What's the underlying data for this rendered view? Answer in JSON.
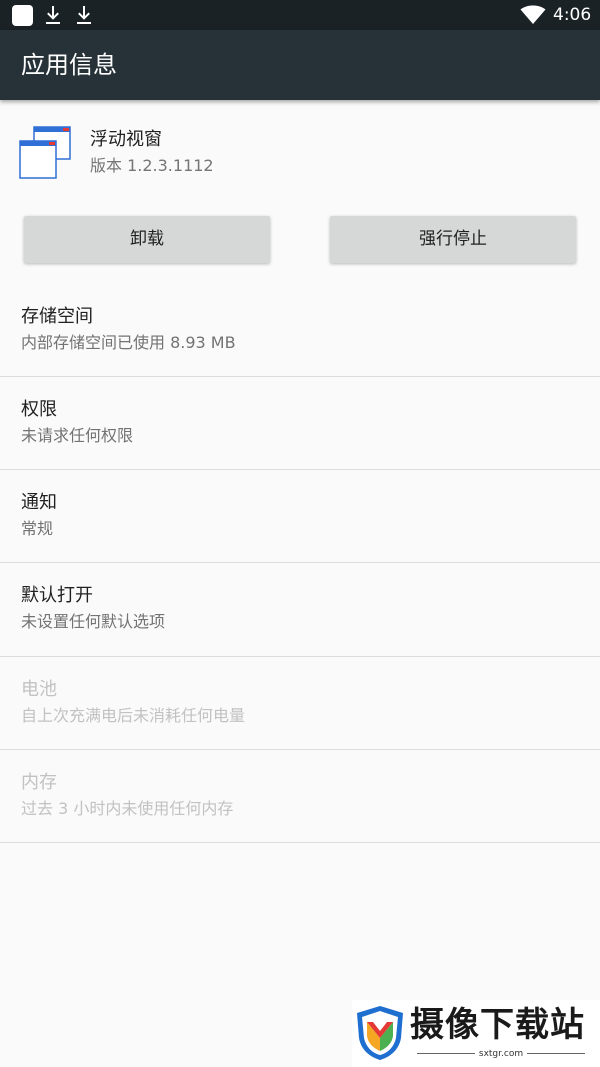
{
  "status_bar": {
    "time": "4:06",
    "icons": [
      "notification-square-icon",
      "download-icon",
      "download-icon",
      "wifi-icon"
    ]
  },
  "app_bar": {
    "title": "应用信息"
  },
  "app": {
    "name": "浮动视窗",
    "version": "版本 1.2.3.1112",
    "icon": "floating-window-app-icon"
  },
  "buttons": {
    "uninstall": "卸载",
    "force_stop": "强行停止"
  },
  "items": [
    {
      "title": "存储空间",
      "summary": "内部存储空间已使用 8.93 MB",
      "enabled": true
    },
    {
      "title": "权限",
      "summary": "未请求任何权限",
      "enabled": true
    },
    {
      "title": "通知",
      "summary": "常规",
      "enabled": true
    },
    {
      "title": "默认打开",
      "summary": "未设置任何默认选项",
      "enabled": true
    },
    {
      "title": "电池",
      "summary": "自上次充满电后未消耗任何电量",
      "enabled": false
    },
    {
      "title": "内存",
      "summary": "过去 3 小时内未使用任何内存",
      "enabled": false
    }
  ],
  "watermark": {
    "text": "摄像下载站",
    "site": "sxtgr.com"
  },
  "colors": {
    "status_bar": "#1b2226",
    "app_bar": "#263238",
    "background": "#fafafa",
    "button": "#d6d7d7",
    "text_primary": "#212121",
    "text_secondary": "#737373",
    "text_disabled": "#c2c2c2",
    "divider": "#dcdcdc"
  }
}
